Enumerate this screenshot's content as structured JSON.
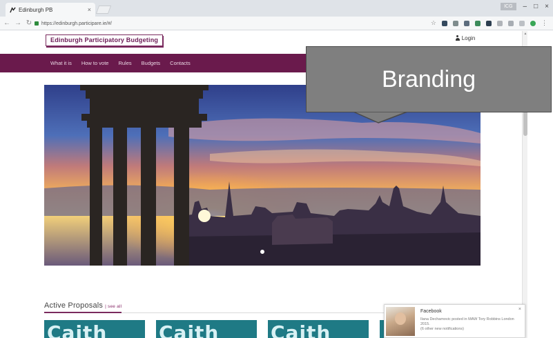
{
  "browser": {
    "tab_title": "Edinburgh PB",
    "tab_close": "×",
    "url": "https://edinburgh.participare.ie/#/",
    "window_user": "ICG",
    "minimize": "–",
    "maximize": "□",
    "close": "×"
  },
  "site": {
    "logo_text": "Edinburgh Participatory Budgeting",
    "login_label": "Login",
    "nav": [
      "What it is",
      "How to vote",
      "Rules",
      "Budgets",
      "Contacts"
    ]
  },
  "proposals": {
    "title": "Active Proposals",
    "see_all": "| see all",
    "card_text": "Caith"
  },
  "callout": {
    "text": "Branding"
  },
  "facebook_popup": {
    "title": "Facebook",
    "text": "Ilana Dechamovic posted in MAW Tory Robbins London 2015.",
    "subtext": "(6 other new notifications)",
    "close": "×"
  },
  "colors": {
    "brand_purple": "#6a1a4c",
    "callout_gray": "#7f7f7f",
    "card_teal": "#1f7a85"
  }
}
